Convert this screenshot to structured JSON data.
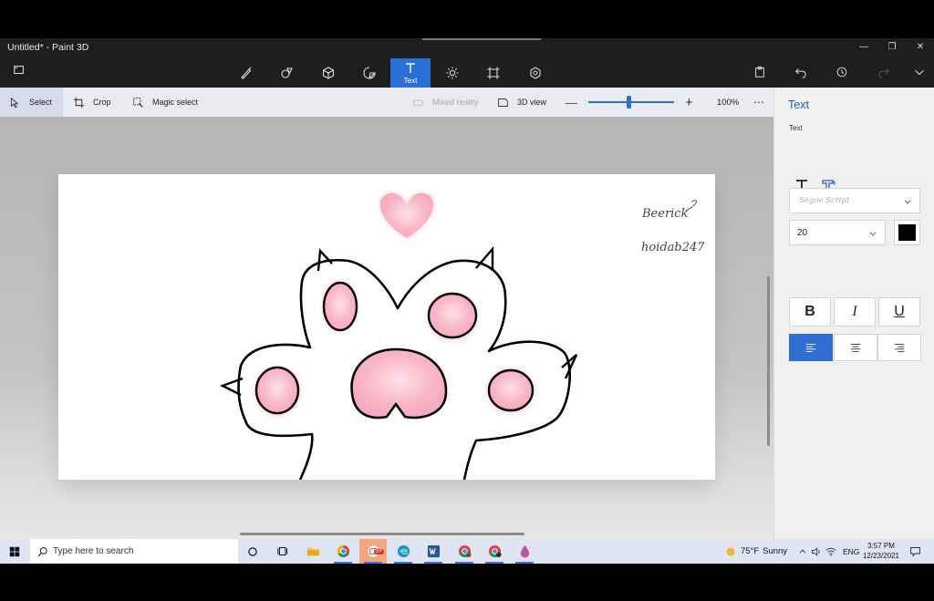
{
  "window": {
    "title": "Untitled* - Paint 3D"
  },
  "toolbar": {
    "tools": [
      {
        "name": "brushes",
        "icon": "brush-icon"
      },
      {
        "name": "2d-shapes",
        "icon": "shapes-2d-icon"
      },
      {
        "name": "3d-shapes",
        "icon": "cube-icon"
      },
      {
        "name": "stickers",
        "icon": "sticker-icon"
      },
      {
        "name": "text",
        "icon": "text-icon",
        "label": "Text",
        "active": true
      },
      {
        "name": "effects",
        "icon": "sun-icon"
      },
      {
        "name": "canvas",
        "icon": "canvas-icon"
      },
      {
        "name": "3d-library",
        "icon": "library-icon"
      }
    ]
  },
  "subbar": {
    "select": "Select",
    "crop": "Crop",
    "magic_select": "Magic select",
    "mixed_reality": "Mixed reality",
    "view_3d": "3D view",
    "zoom_percent": "100%",
    "zoom_level": 0.47
  },
  "canvas": {
    "signature_lines": [
      "Beerick",
      "hoidab247"
    ]
  },
  "panel": {
    "title": "Text",
    "section_label": "Text",
    "font_name": "Segoe Script",
    "font_size": "20",
    "text_color": "#000000",
    "bold": "B",
    "italic": "I",
    "underline": "U",
    "alignment": "left"
  },
  "colors": {
    "accent": "#2f6fd4",
    "paw_pink": "#f9b6c8",
    "outline": "#000000"
  },
  "taskbar": {
    "search_placeholder": "Type here to search",
    "weather_temp": "75°F",
    "weather_text": "Sunny",
    "language": "ENG",
    "time": "3:57 PM",
    "date": "12/23/2021",
    "mail_badge": "5+"
  }
}
